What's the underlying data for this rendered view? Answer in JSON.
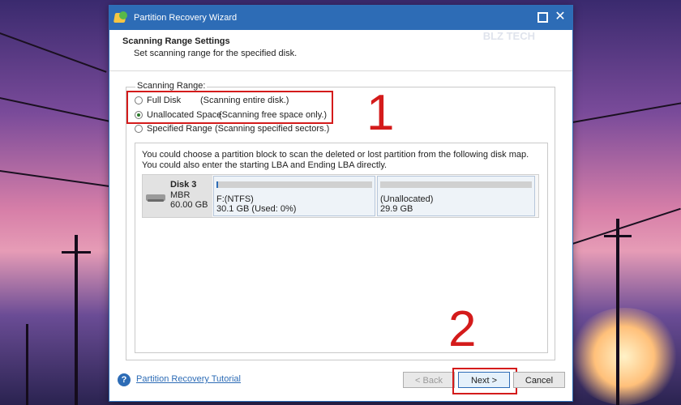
{
  "window": {
    "title": "Partition Recovery Wizard"
  },
  "header": {
    "title": "Scanning Range Settings",
    "subtitle": "Set scanning range for the specified disk."
  },
  "scanning_range": {
    "legend": "Scanning Range:",
    "options": [
      {
        "label": "Full Disk",
        "desc": "(Scanning entire disk.)",
        "selected": false
      },
      {
        "label": "Unallocated Space",
        "desc": "(Scanning free space only.)",
        "selected": true
      },
      {
        "label": "Specified Range",
        "desc": "(Scanning specified sectors.)",
        "selected": false
      }
    ]
  },
  "disk_map": {
    "description": "You could choose a partition block to scan the deleted or lost partition from the following disk map. You could also enter the starting LBA and Ending LBA directly.",
    "disk": {
      "name": "Disk 3",
      "type": "MBR",
      "size": "60.00 GB"
    },
    "partitions": [
      {
        "label": "F:(NTFS)",
        "detail": "30.1 GB (Used: 0%)",
        "used_fraction": 0.0
      },
      {
        "label": "(Unallocated)",
        "detail": "29.9 GB",
        "used_fraction": 0.0
      }
    ]
  },
  "footer": {
    "tutorial_link": "Partition Recovery Tutorial",
    "back_label": "< Back",
    "next_label": "Next >",
    "cancel_label": "Cancel"
  },
  "annotations": {
    "step1": "1",
    "step2": "2",
    "color": "#d41b1b"
  },
  "watermark": "BLZ TECH",
  "colors": {
    "accent": "#2d6cb6"
  }
}
